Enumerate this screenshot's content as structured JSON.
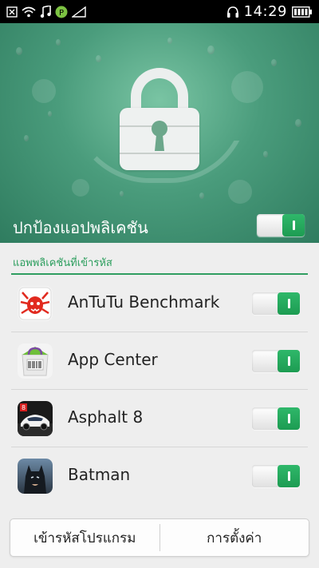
{
  "status_bar": {
    "time": "14:29",
    "icons": [
      "close-box-icon",
      "wifi-icon",
      "music-note-icon",
      "p-badge-icon",
      "signal-icon",
      "headphones-icon",
      "battery-icon"
    ]
  },
  "hero": {
    "title": "ปกป้องแอปพลิเคชัน",
    "toggle_on": true,
    "lock_icon": "lock-icon"
  },
  "section": {
    "header": "แอพพลิเคชันที่เข้ารหัส"
  },
  "apps": [
    {
      "name": "AnTuTu Benchmark",
      "icon": "antutu-icon",
      "enabled": true
    },
    {
      "name": "App Center",
      "icon": "app-center-icon",
      "enabled": true
    },
    {
      "name": "Asphalt 8",
      "icon": "asphalt-8-icon",
      "enabled": true
    },
    {
      "name": "Batman",
      "icon": "batman-icon",
      "enabled": true
    }
  ],
  "buttons": {
    "encrypt": "เข้ารหัสโปรแกรม",
    "settings": "การตั้งค่า"
  },
  "colors": {
    "accent_green": "#2a9d5c",
    "toggle_green": "#1d9c52",
    "hero_green": "#4a9c7c"
  }
}
